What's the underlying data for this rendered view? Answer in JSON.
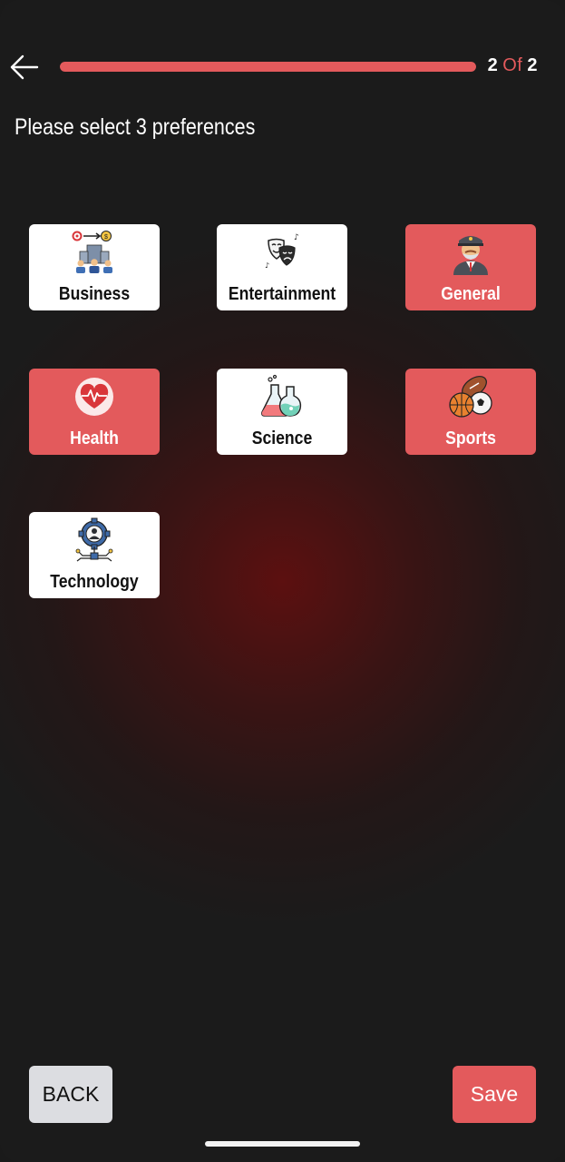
{
  "header": {
    "progress_fraction": 1.0,
    "step_current": "2",
    "step_of": "Of",
    "step_total": "2"
  },
  "title": "Please select 3 preferences",
  "categories": [
    {
      "label": "Business",
      "icon": "business-people-icon",
      "selected": false
    },
    {
      "label": "Entertainment",
      "icon": "theater-masks-icon",
      "selected": false
    },
    {
      "label": "General",
      "icon": "officer-avatar-icon",
      "selected": true
    },
    {
      "label": "Health",
      "icon": "heart-pulse-icon",
      "selected": true
    },
    {
      "label": "Science",
      "icon": "chemistry-flasks-icon",
      "selected": false
    },
    {
      "label": "Sports",
      "icon": "sports-balls-icon",
      "selected": true
    },
    {
      "label": "Technology",
      "icon": "tech-gear-person-icon",
      "selected": false
    }
  ],
  "footer": {
    "back_label": "BACK",
    "save_label": "Save"
  },
  "colors": {
    "accent": "#e35a5c",
    "background": "#1b1b1b",
    "card": "#ffffff",
    "back_button": "#dcdde1"
  }
}
